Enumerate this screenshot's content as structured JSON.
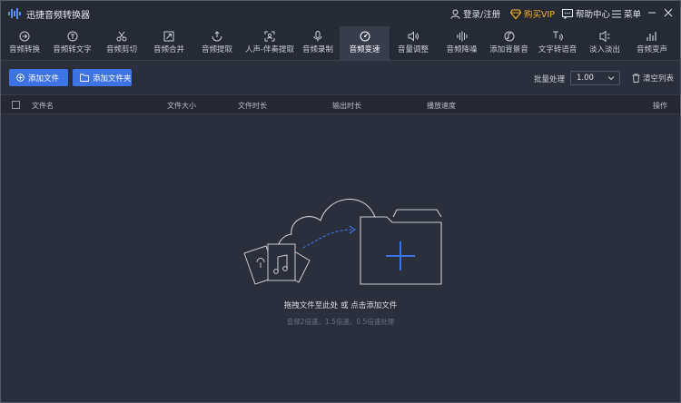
{
  "app": {
    "title": "迅捷音频转换器",
    "login": "登录/注册",
    "vip": "购买VIP",
    "help": "帮助中心",
    "menu": "菜单"
  },
  "toolbar": [
    {
      "label": "音频转换",
      "icon": "convert-icon"
    },
    {
      "label": "音频转文字",
      "icon": "audio-to-text-icon"
    },
    {
      "label": "音频剪切",
      "icon": "scissors-icon"
    },
    {
      "label": "音频合并",
      "icon": "merge-icon"
    },
    {
      "label": "音频提取",
      "icon": "extract-icon"
    },
    {
      "label": "人声-伴奏提取",
      "icon": "vocal-extract-icon"
    },
    {
      "label": "音频录制",
      "icon": "microphone-icon"
    },
    {
      "label": "音频变速",
      "icon": "speedometer-icon",
      "active": true
    },
    {
      "label": "音量调整",
      "icon": "volume-icon"
    },
    {
      "label": "音频降噪",
      "icon": "denoise-icon"
    },
    {
      "label": "添加背景音",
      "icon": "background-music-icon"
    },
    {
      "label": "文字转语音",
      "icon": "text-to-speech-icon"
    },
    {
      "label": "淡入淡出",
      "icon": "fade-icon"
    },
    {
      "label": "音频变声",
      "icon": "voice-change-icon"
    }
  ],
  "actions": {
    "add_file": "添加文件",
    "add_folder": "添加文件夹",
    "batch_label": "批量处理",
    "speed_value": "1.00",
    "clear_list": "清空列表"
  },
  "table": {
    "columns": [
      "文件名",
      "文件大小",
      "文件时长",
      "输出时长",
      "播放速度",
      "操作"
    ]
  },
  "empty": {
    "main": "拖拽文件至此处 或 点击添加文件",
    "sub": "音频2倍速、1.5倍速、0.5倍速处理"
  },
  "colors": {
    "accent": "#3e73e6",
    "vip": "#f5b51f",
    "background": "#2b2f3b",
    "titlebar": "#262a35"
  }
}
